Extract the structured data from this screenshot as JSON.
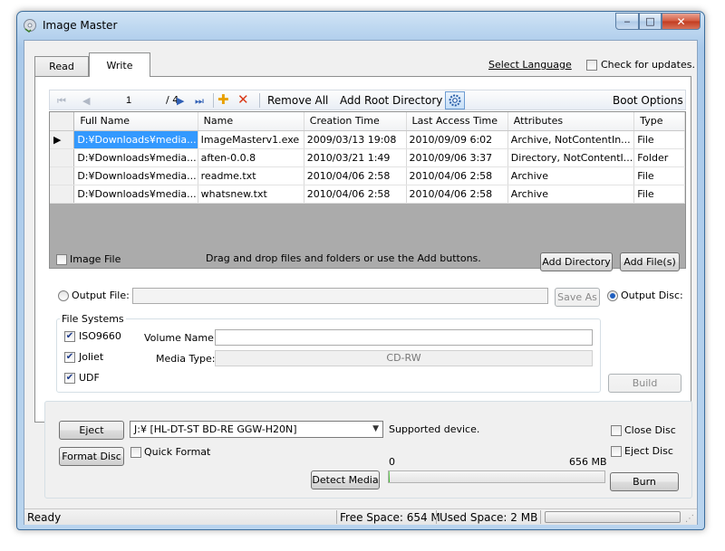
{
  "window": {
    "title": "Image Master",
    "min_glyph": "‒",
    "max_glyph": "□",
    "close_glyph": "✕"
  },
  "tabs": [
    {
      "label": "Read"
    },
    {
      "label": "Write"
    }
  ],
  "header": {
    "select_language": "Select Language",
    "check_updates": "Check for updates."
  },
  "toolbar": {
    "page_current": "1",
    "page_total": "/ 4",
    "remove_all": "Remove All",
    "add_root_directory": "Add Root Directory",
    "boot_options": "Boot Options",
    "icons": [
      "first-page-icon",
      "prev-page-icon",
      "next-page-icon",
      "last-page-icon",
      "add-icon",
      "remove-icon",
      "gear-icon"
    ]
  },
  "grid": {
    "columns": [
      "Full Name",
      "Name",
      "Creation Time",
      "Last Access Time",
      "Attributes",
      "Type"
    ],
    "rows": [
      {
        "marker": "▶",
        "cells": [
          "D:¥Downloads¥media...",
          "ImageMasterv1.exe",
          "2009/03/13 19:08",
          "2010/09/09 6:02",
          "Archive, NotContentIn...",
          "File"
        ]
      },
      {
        "marker": "",
        "cells": [
          "D:¥Downloads¥media...",
          "aften-0.0.8",
          "2010/03/21 1:49",
          "2010/09/06 3:37",
          "Directory, NotContentI...",
          "Folder"
        ]
      },
      {
        "marker": "",
        "cells": [
          "D:¥Downloads¥media...",
          "readme.txt",
          "2010/04/06 2:58",
          "2010/04/06 2:58",
          "Archive",
          "File"
        ]
      },
      {
        "marker": "",
        "cells": [
          "D:¥Downloads¥media...",
          "whatsnew.txt",
          "2010/04/06 2:58",
          "2010/04/06 2:58",
          "Archive",
          "File"
        ]
      }
    ]
  },
  "file_area": {
    "image_file": "Image File",
    "drag_hint": "Drag and drop files and folders or use the Add buttons.",
    "add_directory": "Add Directory",
    "add_files": "Add File(s)"
  },
  "output": {
    "output_file_label": "Output File:",
    "output_file_value": "",
    "save_as": "Save As",
    "output_disc_label": "Output Disc:",
    "selected": "disc"
  },
  "file_systems": {
    "legend": "File Systems",
    "iso9660": "ISO9660",
    "joliet": "Joliet",
    "udf": "UDF",
    "volume_name_label": "Volume Name:",
    "volume_name_value": "",
    "media_type_label": "Media Type:",
    "media_type_value": "CD-RW",
    "build": "Build"
  },
  "drive": {
    "eject": "Eject",
    "selected_drive": "J:¥ [HL-DT-ST BD-RE  GGW-H20N]",
    "supported": "Supported device.",
    "close_disc": "Close Disc",
    "format_disc": "Format Disc",
    "quick_format": "Quick Format",
    "eject_disc": "Eject Disc",
    "capacity_min": "0",
    "capacity_max": "656 MB",
    "capacity_used_fraction": 0.003,
    "detect_media": "Detect Media",
    "burn": "Burn"
  },
  "status": {
    "ready": "Ready",
    "free_space": "Free Space: 654 M",
    "used_space": "Used Space: 2 MB"
  },
  "colors": {
    "selection": "#3399ff",
    "accent": "#2f5fb5",
    "add": "#e8a000",
    "remove": "#d93a1a"
  }
}
